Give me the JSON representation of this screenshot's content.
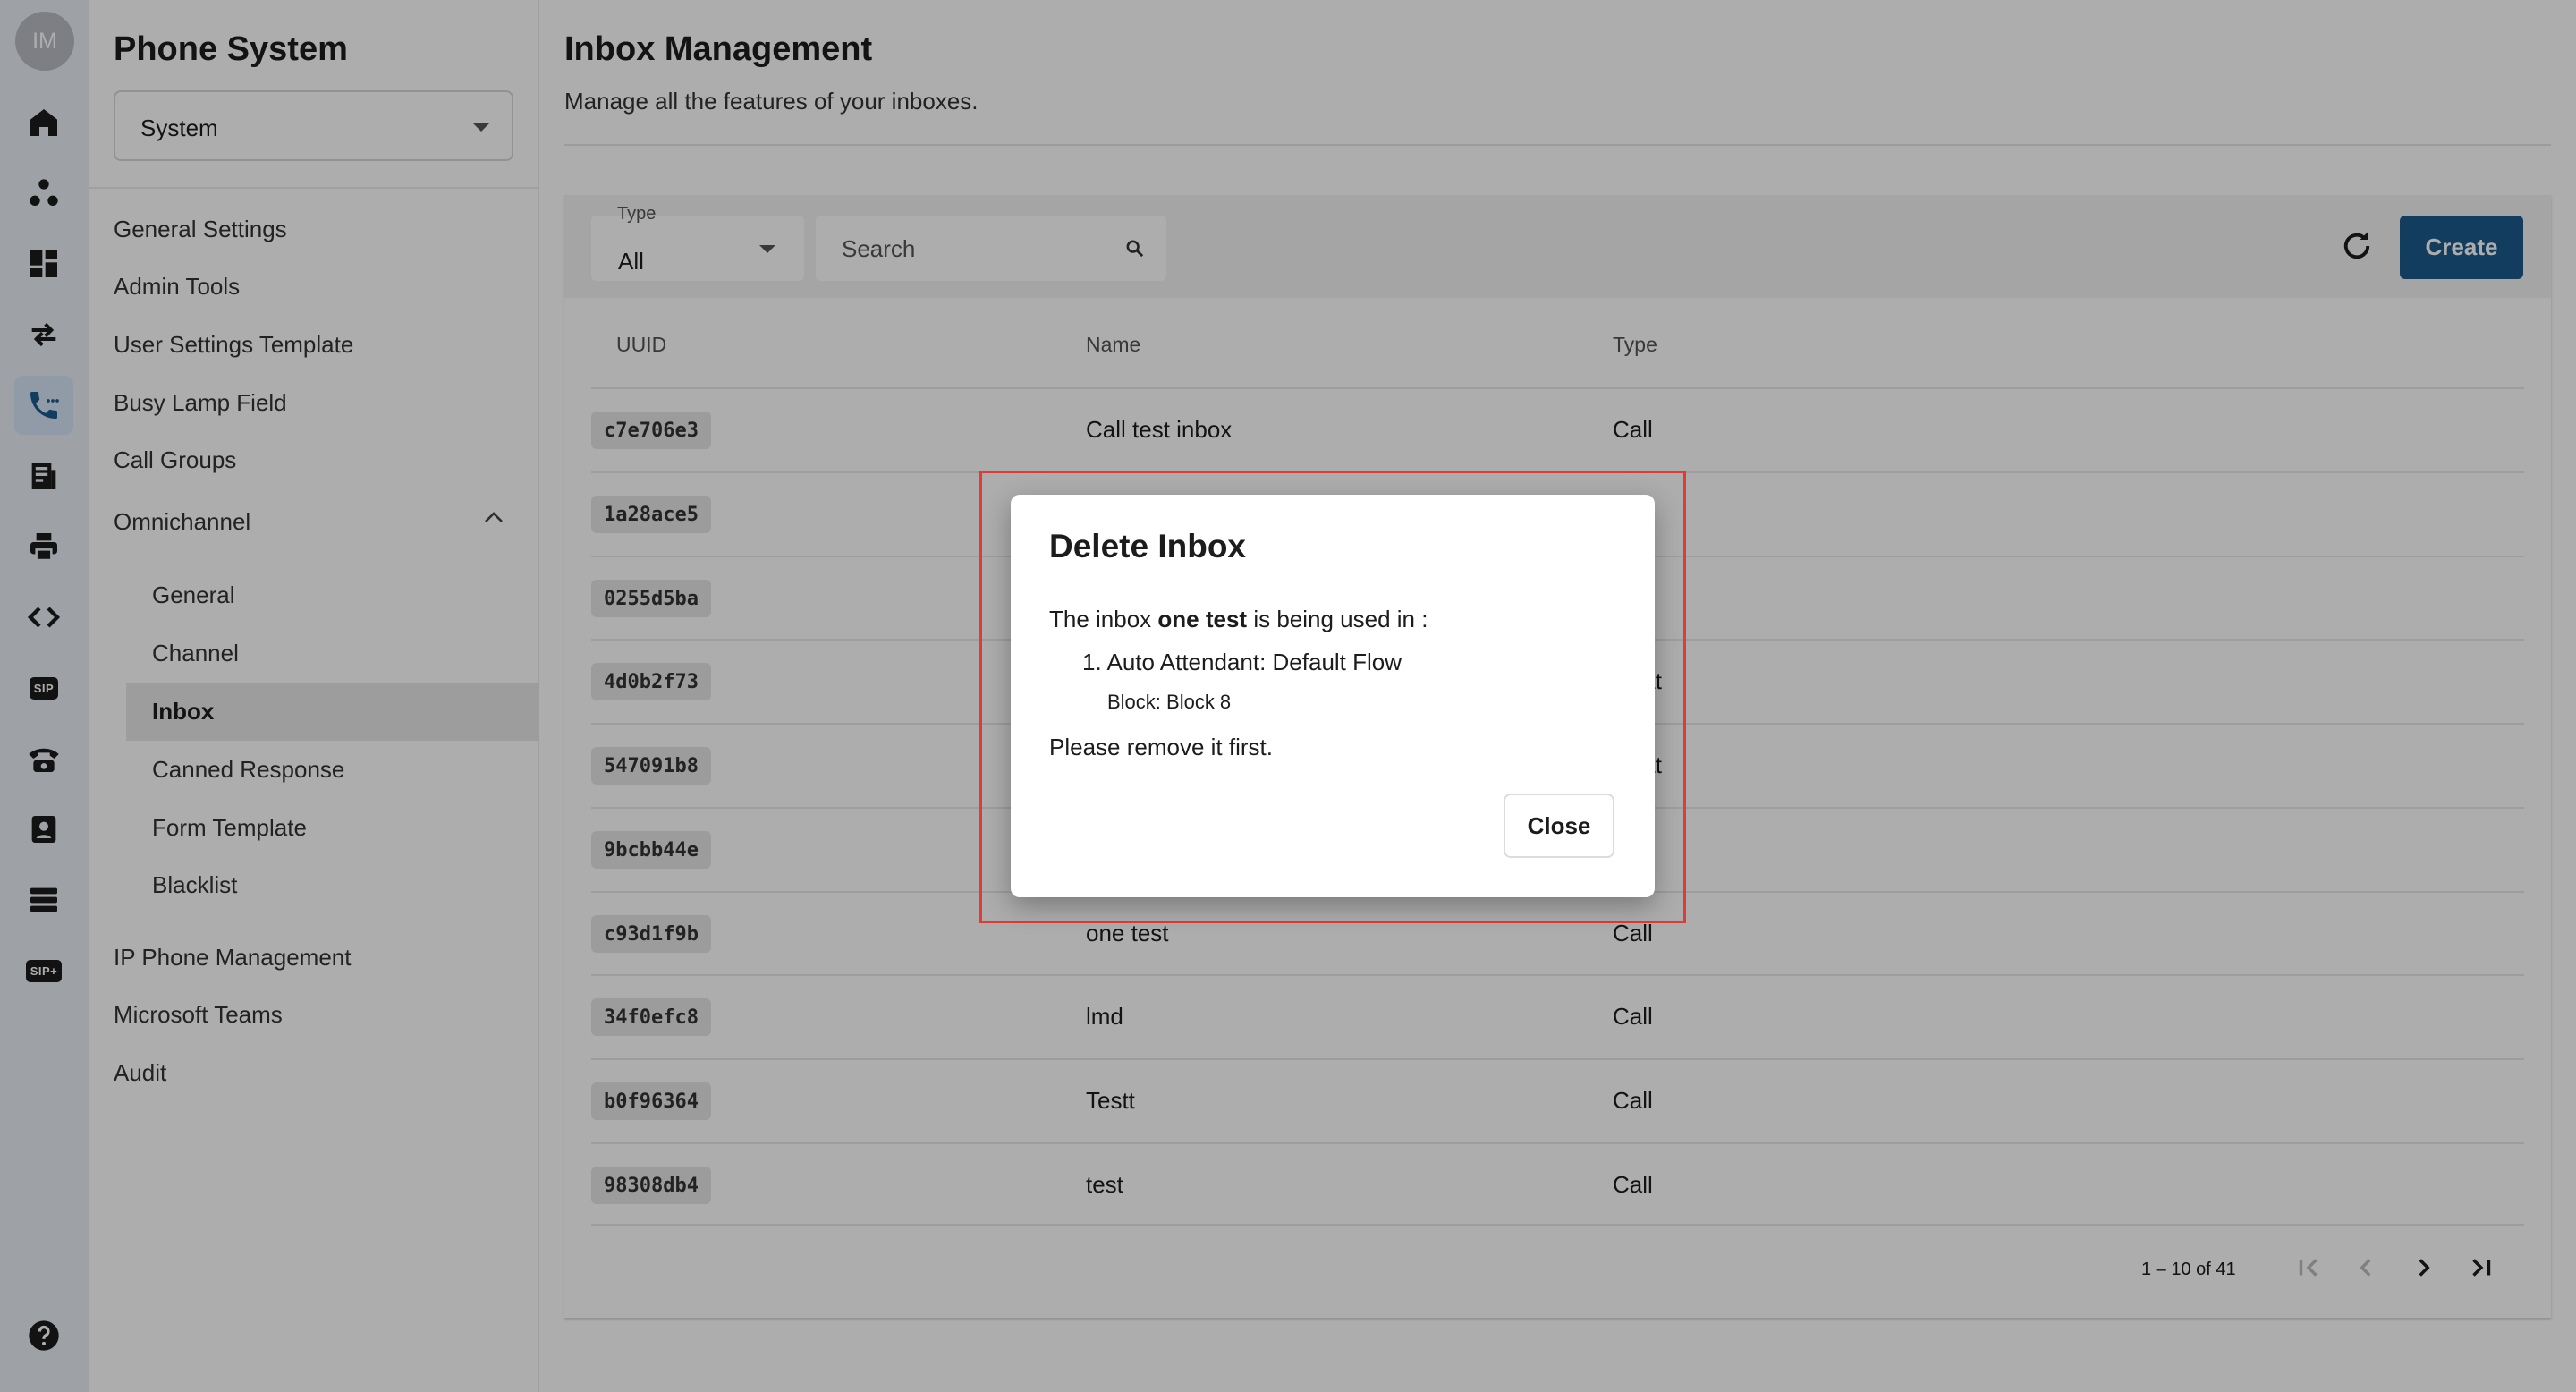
{
  "rail": {
    "avatar_initials": "IM",
    "items": [
      "home-icon",
      "nodes-icon",
      "dashboard-icon",
      "transfer-icon",
      "phone-icon",
      "receipt-icon",
      "printer-icon",
      "code-icon",
      "sip-icon",
      "rotary-phone-icon",
      "contact-card-icon",
      "server-icon",
      "sip-plus-icon"
    ],
    "active": "phone-icon",
    "sip_label": "SIP",
    "sip_plus_label": "SIP+",
    "help": "help-icon"
  },
  "sidebar": {
    "title": "Phone System",
    "selector_value": "System",
    "items": {
      "general_settings": "General Settings",
      "admin_tools": "Admin Tools",
      "user_settings_template": "User Settings Template",
      "busy_lamp_field": "Busy Lamp Field",
      "call_groups": "Call Groups",
      "omnichannel": "Omnichannel",
      "ip_phone_management": "IP Phone Management",
      "microsoft_teams": "Microsoft Teams",
      "audit": "Audit"
    },
    "omnichannel_sub": {
      "general": "General",
      "channel": "Channel",
      "inbox": "Inbox",
      "canned_response": "Canned Response",
      "form_template": "Form Template",
      "blacklist": "Blacklist"
    },
    "active": "Inbox"
  },
  "main": {
    "title": "Inbox Management",
    "subtitle": "Manage all the features of your inboxes.",
    "filter": {
      "type_label": "Type",
      "type_value": "All",
      "search_placeholder": "Search"
    },
    "create_label": "Create",
    "table": {
      "headers": {
        "uuid": "UUID",
        "name": "Name",
        "type": "Type"
      },
      "rows": [
        {
          "uuid": "c7e706e3",
          "name": "Call test inbox",
          "type": "Call"
        },
        {
          "uuid": "1a28ace5",
          "name": "",
          "type": ""
        },
        {
          "uuid": "0255d5ba",
          "name": "",
          "type": ""
        },
        {
          "uuid": "4d0b2f73",
          "name": "",
          "type": "Chat"
        },
        {
          "uuid": "547091b8",
          "name": "",
          "type": "Chat"
        },
        {
          "uuid": "9bcbb44e",
          "name": "",
          "type": ""
        },
        {
          "uuid": "c93d1f9b",
          "name": "one test",
          "type": "Call"
        },
        {
          "uuid": "34f0efc8",
          "name": "lmd",
          "type": "Call"
        },
        {
          "uuid": "b0f96364",
          "name": "Testt",
          "type": "Call"
        },
        {
          "uuid": "98308db4",
          "name": "test",
          "type": "Call"
        }
      ]
    },
    "pagination": {
      "range_text": "1 – 10 of 41"
    }
  },
  "modal": {
    "title": "Delete Inbox",
    "line_prefix": "The inbox ",
    "inbox_name": "one test",
    "line_suffix": " is being used in :",
    "item_number": "1.",
    "item_text": "Auto Attendant: Default Flow",
    "block_text": "Block: Block 8",
    "remove_text": "Please remove it first.",
    "close_label": "Close"
  },
  "colors": {
    "primary": "#1d5a8c",
    "rail_active": "#d4e5f7",
    "rail_bg": "#e9edf5",
    "highlight": "#e53935"
  }
}
